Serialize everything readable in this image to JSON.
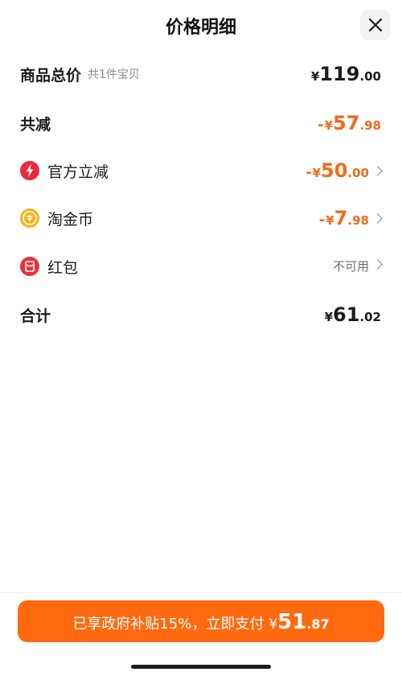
{
  "header": {
    "title": "价格明细",
    "close_icon": "close-icon"
  },
  "rows": {
    "total_price": {
      "label": "商品总价",
      "sub": "共1件宝贝",
      "yen": "¥",
      "int": "119",
      "dec": ".00"
    },
    "total_discount": {
      "label": "共减",
      "minus": "-",
      "yen": "¥",
      "int": "57",
      "dec": ".98"
    },
    "official_discount": {
      "label": "官方立减",
      "minus": "-",
      "yen": "¥",
      "int": "50",
      "dec": ".00",
      "icon": "lightning-icon"
    },
    "taojin_coin": {
      "label": "淘金币",
      "minus": "-",
      "yen": "¥",
      "int": "7",
      "dec": ".98",
      "icon": "coin-icon"
    },
    "red_packet": {
      "label": "红包",
      "status": "不可用",
      "icon": "red-packet-icon"
    },
    "sum": {
      "label": "合计",
      "yen": "¥",
      "int": "61",
      "dec": ".02"
    }
  },
  "footer": {
    "text": "已享政府补贴15%，立即支付",
    "yen": "¥",
    "int": "51",
    "dec": ".87"
  },
  "colors": {
    "accent": "#ff6a10",
    "discount": "#f26a1b"
  }
}
